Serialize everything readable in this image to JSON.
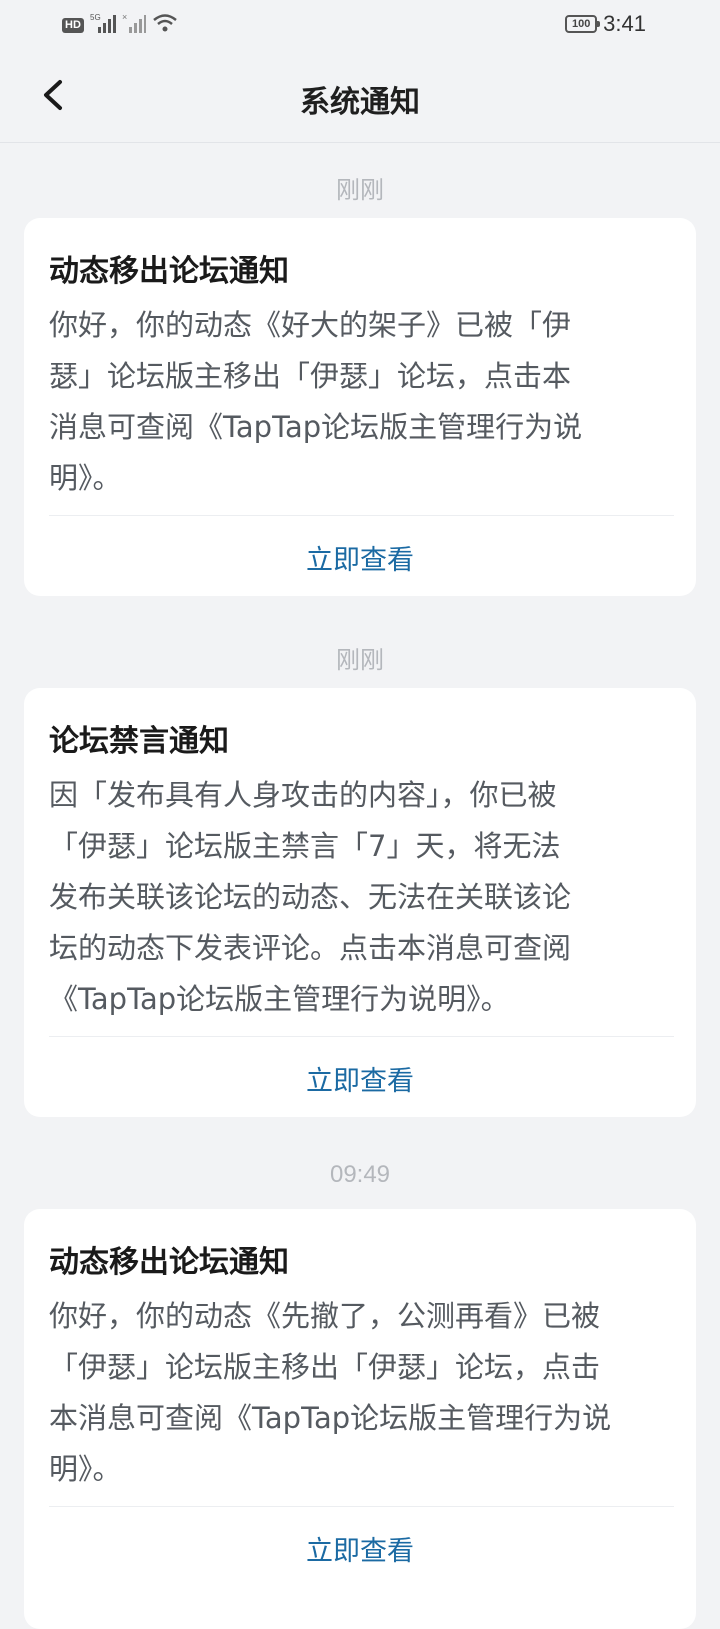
{
  "status_bar": {
    "hd_label": "HD",
    "network_label": "5G",
    "battery": "100",
    "time": "3:41"
  },
  "header": {
    "title": "系统通知"
  },
  "notifications": [
    {
      "time": "刚刚",
      "title": "动态移出论坛通知",
      "lines": [
        "你好，你的动态《好大的架子》已被「伊",
        "瑟」论坛版主移出「伊瑟」论坛，点击本",
        "消息可查阅《TapTap论坛版主管理行为说",
        "明》。"
      ],
      "action": "立即查看"
    },
    {
      "time": "刚刚",
      "title": "论坛禁言通知",
      "lines": [
        "因「发布具有人身攻击的内容」，你已被",
        "「伊瑟」论坛版主禁言「7」天，将无法",
        "发布关联该论坛的动态、无法在关联该论",
        "坛的动态下发表评论。点击本消息可查阅",
        "《TapTap论坛版主管理行为说明》。"
      ],
      "action": "立即查看"
    },
    {
      "time": "09:49",
      "title": "动态移出论坛通知",
      "lines": [
        "你好，你的动态《先撤了，公测再看》已被",
        "「伊瑟」论坛版主移出「伊瑟」论坛，点击",
        "本消息可查阅《TapTap论坛版主管理行为说",
        "明》。"
      ],
      "action": "立即查看"
    }
  ]
}
